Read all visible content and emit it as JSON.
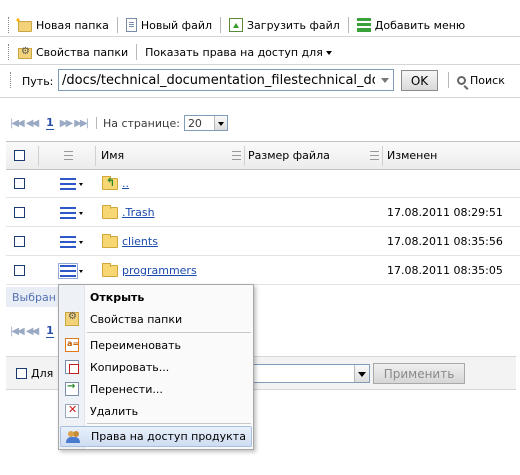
{
  "toolbar1": {
    "new_folder": "Новая папка",
    "new_file": "Новый файл",
    "upload_file": "Загрузить файл",
    "add_menu": "Добавить меню"
  },
  "toolbar2": {
    "folder_properties": "Свойства папки",
    "show_access_for": "Показать права на доступ для"
  },
  "pathbar": {
    "label": "Путь:",
    "value": "/docs/technical_documentation_filestechnical_doc",
    "ok": "OK",
    "search": "Поиск"
  },
  "pager": {
    "current_page": "1",
    "per_page_label": "На странице:",
    "per_page_value": "20"
  },
  "table": {
    "col_name": "Имя",
    "col_size": "Размер файла",
    "col_modified": "Изменен",
    "rows": [
      {
        "name": "..",
        "modified": ""
      },
      {
        "name": ".Trash",
        "modified": "17.08.2011 08:29:51"
      },
      {
        "name": "clients",
        "modified": "17.08.2011 08:35:56"
      },
      {
        "name": "programmers",
        "modified": "17.08.2011 08:35:05"
      }
    ],
    "selected_label": "Выбран"
  },
  "bottom": {
    "for_label": "Для",
    "apply": "Применить"
  },
  "context_menu": {
    "open": "Открыть",
    "folder_properties": "Свойства папки",
    "rename": "Переименовать",
    "copy": "Копировать...",
    "move": "Перенести...",
    "delete": "Удалить",
    "access_rights": "Права на доступ продукта"
  },
  "colors": {
    "link": "#1c4aad",
    "row_menu_icon": "#2e58c8",
    "menu_highlight": "#cfdcf1"
  }
}
